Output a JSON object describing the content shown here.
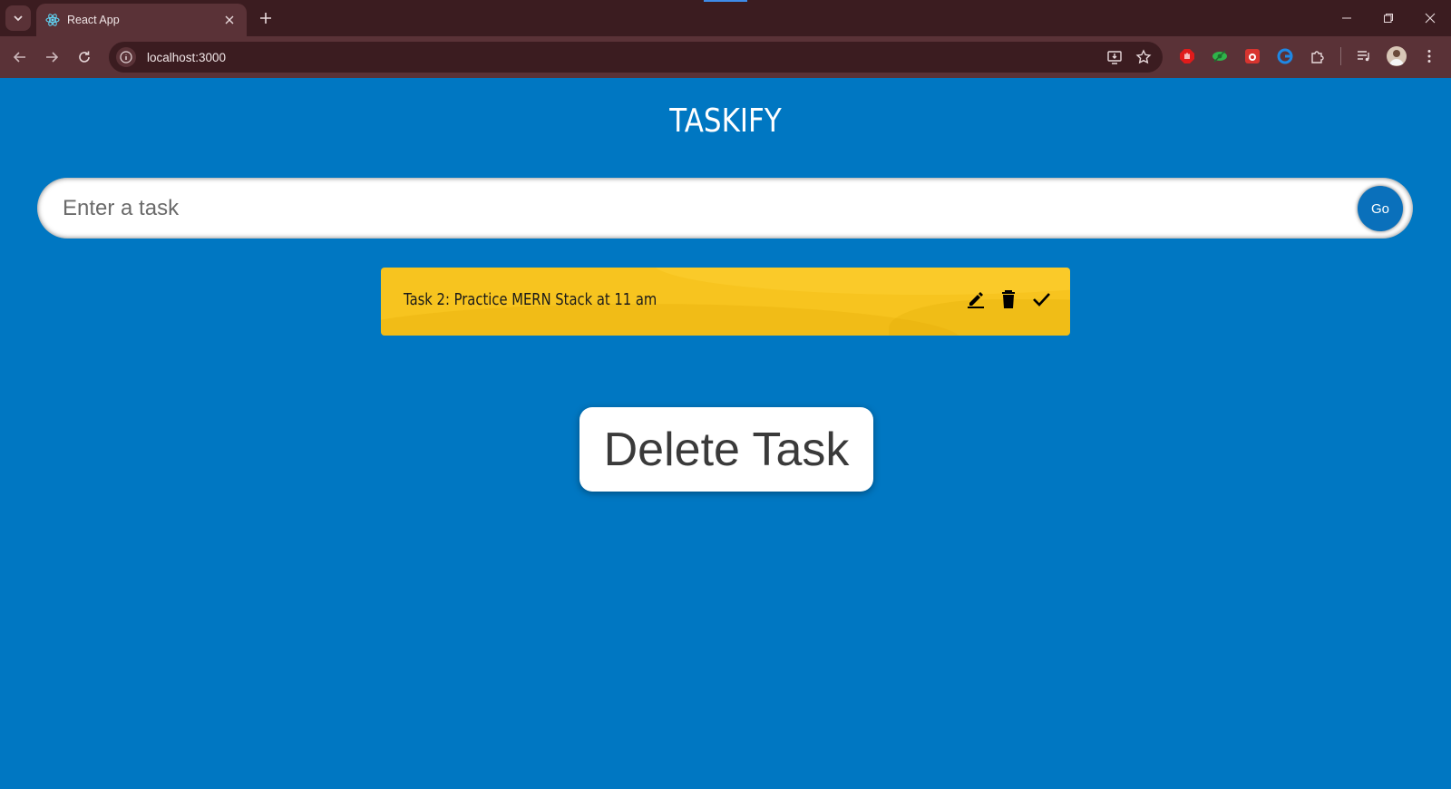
{
  "browser": {
    "tab": {
      "title": "React App",
      "favicon": "react-icon"
    },
    "url": "localhost:3000",
    "icons": {
      "tab_search": "chevron-down-icon",
      "tab_close": "close-icon",
      "new_tab": "plus-icon",
      "back": "back-arrow-icon",
      "forward": "forward-arrow-icon",
      "reload": "reload-icon",
      "site_info": "info-icon",
      "install": "install-app-icon",
      "bookmark": "star-icon",
      "extensions": [
        "adblock-extension-icon",
        "green-extension-icon",
        "red-extension-icon",
        "blue-extension-icon",
        "puzzle-icon"
      ],
      "media": "media-control-icon",
      "profile": "avatar",
      "menu": "kebab-menu-icon"
    },
    "colors": {
      "frame": "#3b1c20",
      "toolbar": "#5a3237"
    }
  },
  "app": {
    "title": "TASKIFY",
    "input": {
      "placeholder": "Enter a task",
      "value": ""
    },
    "go_label": "Go",
    "tasks": [
      {
        "text": "Task 2: Practice MERN Stack at 11 am",
        "actions": [
          "edit-icon",
          "delete-icon",
          "check-icon"
        ]
      }
    ],
    "delete_button_label": "Delete Task",
    "colors": {
      "background": "#0077c2",
      "task_card": "#f7c41f",
      "go_button": "#0a70bb"
    }
  }
}
